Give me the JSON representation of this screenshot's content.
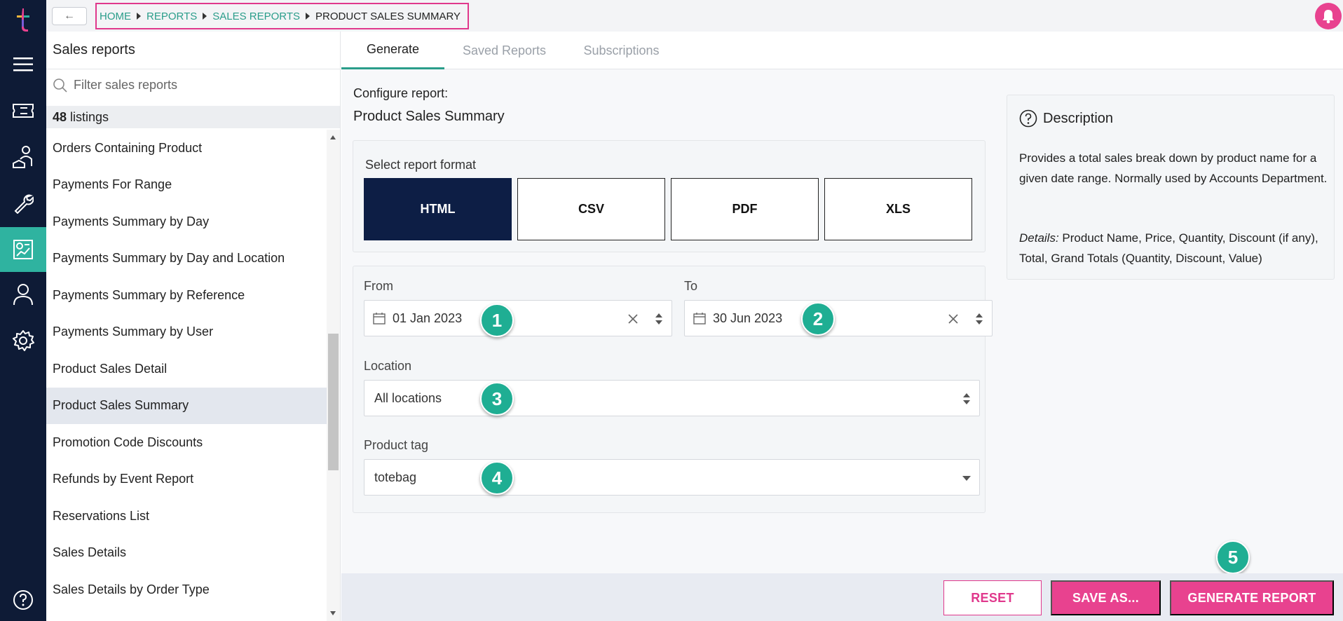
{
  "topbar": {
    "back_label": "←",
    "breadcrumb": [
      "HOME",
      "REPORTS",
      "SALES REPORTS",
      "PRODUCT SALES SUMMARY"
    ]
  },
  "sidebar": {
    "title": "Sales reports",
    "filter_placeholder": "Filter sales reports",
    "count": "48",
    "count_suffix": "listings",
    "items": [
      "Orders Containing Product",
      "Payments For Range",
      "Payments Summary by Day",
      "Payments Summary by Day and Location",
      "Payments Summary by Reference",
      "Payments Summary by User",
      "Product Sales Detail",
      "Product Sales Summary",
      "Promotion Code Discounts",
      "Refunds by Event Report",
      "Reservations List",
      "Sales Details",
      "Sales Details by Order Type"
    ],
    "selected_index": 7,
    "scroll_fraction": 0.58
  },
  "tabs": [
    "Generate",
    "Saved Reports",
    "Subscriptions"
  ],
  "configure": {
    "label": "Configure report:",
    "title": "Product Sales Summary"
  },
  "format": {
    "label": "Select report format",
    "options": [
      "HTML",
      "CSV",
      "PDF",
      "XLS"
    ],
    "selected": "HTML"
  },
  "params": {
    "from_label": "From",
    "from_value": "01 Jan 2023",
    "to_label": "To",
    "to_value": "30 Jun 2023",
    "location_label": "Location",
    "location_value": "All locations",
    "tag_label": "Product tag",
    "tag_value": "totebag"
  },
  "badges": [
    "1",
    "2",
    "3",
    "4",
    "5"
  ],
  "description": {
    "title": "Description",
    "body": "Provides a total sales break down by product name for a given date range. Normally used by Accounts Department.",
    "details_label": "Details:",
    "details_text": " Product Name, Price, Quantity, Discount (if any), Total, Grand Totals (Quantity, Discount, Value)"
  },
  "footer": {
    "reset_label": "RESET",
    "save_label": "SAVE AS...",
    "generate_label": "GENERATE REPORT"
  },
  "colors": {
    "rail": "#0e1b36",
    "accent_teal": "#2fb3a0",
    "pink": "#e8428f",
    "navy_selected": "#0d1e45"
  }
}
